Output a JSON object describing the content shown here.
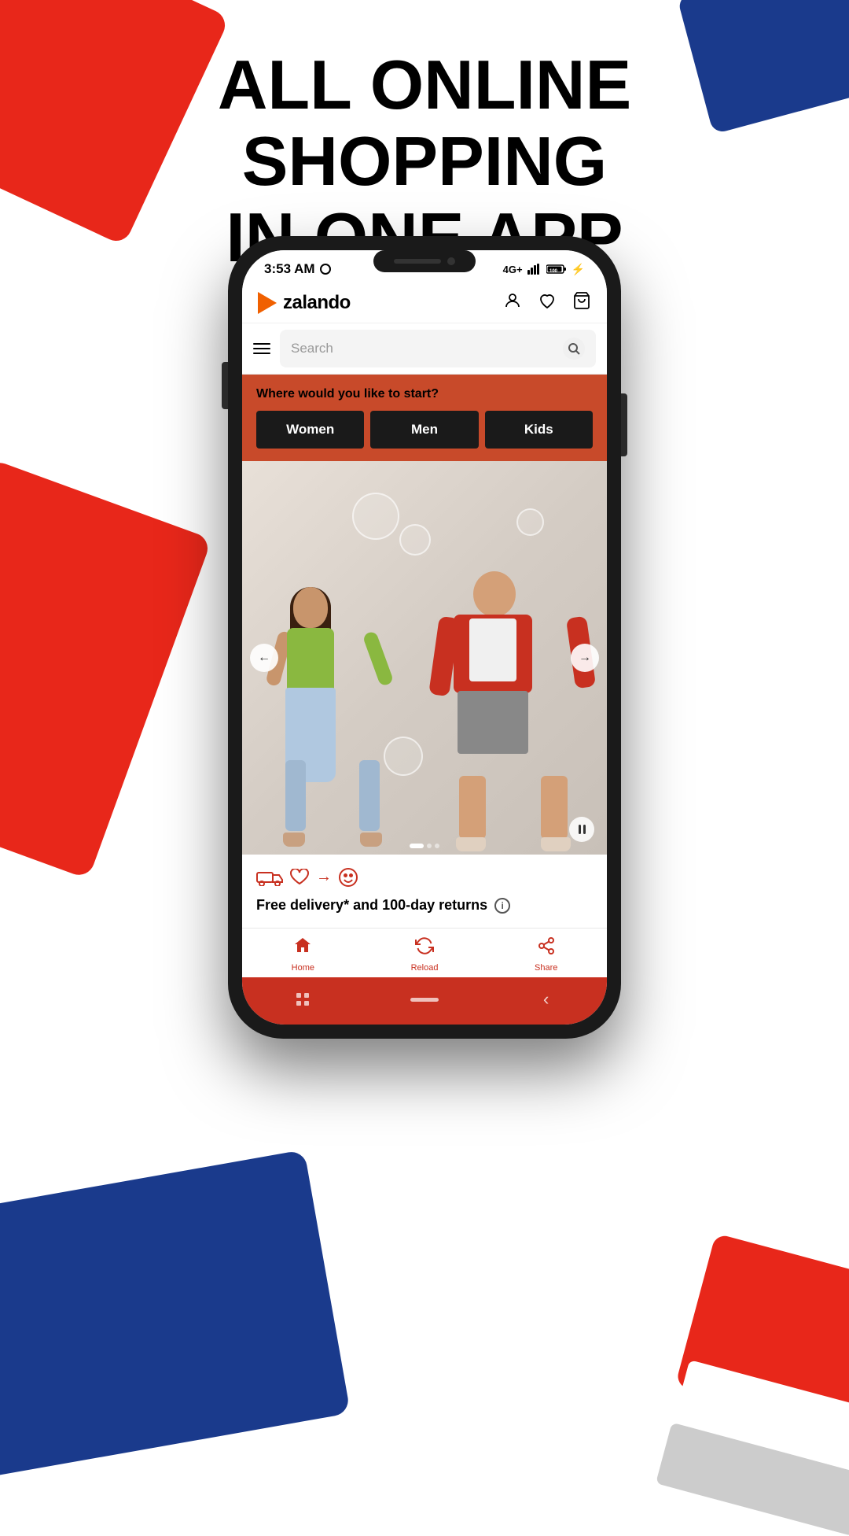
{
  "page": {
    "background_headline": "ALL ONLINE SHOPPING IN ONE APP",
    "headline_line1": "ALL ONLINE SHOPPING",
    "headline_line2": "IN ONE APP"
  },
  "status_bar": {
    "time": "3:53 AM",
    "network": "4G+",
    "battery": "100"
  },
  "header": {
    "logo_text": "zalando",
    "user_icon": "👤",
    "wishlist_icon": "♡",
    "cart_icon": "🛍"
  },
  "search": {
    "placeholder": "Search"
  },
  "category": {
    "question": "Where would you like to start?",
    "buttons": [
      {
        "label": "Women"
      },
      {
        "label": "Men"
      },
      {
        "label": "Kids"
      }
    ]
  },
  "hero": {
    "nav_left": "←",
    "nav_right": "→"
  },
  "delivery": {
    "text": "Free delivery* and 100-day returns",
    "icons": "🚚 ♡ → ☺"
  },
  "bottom_nav": {
    "items": [
      {
        "label": "Home",
        "icon": "🏠"
      },
      {
        "label": "Reload",
        "icon": "🔄"
      },
      {
        "label": "Share",
        "icon": "📤"
      }
    ]
  }
}
